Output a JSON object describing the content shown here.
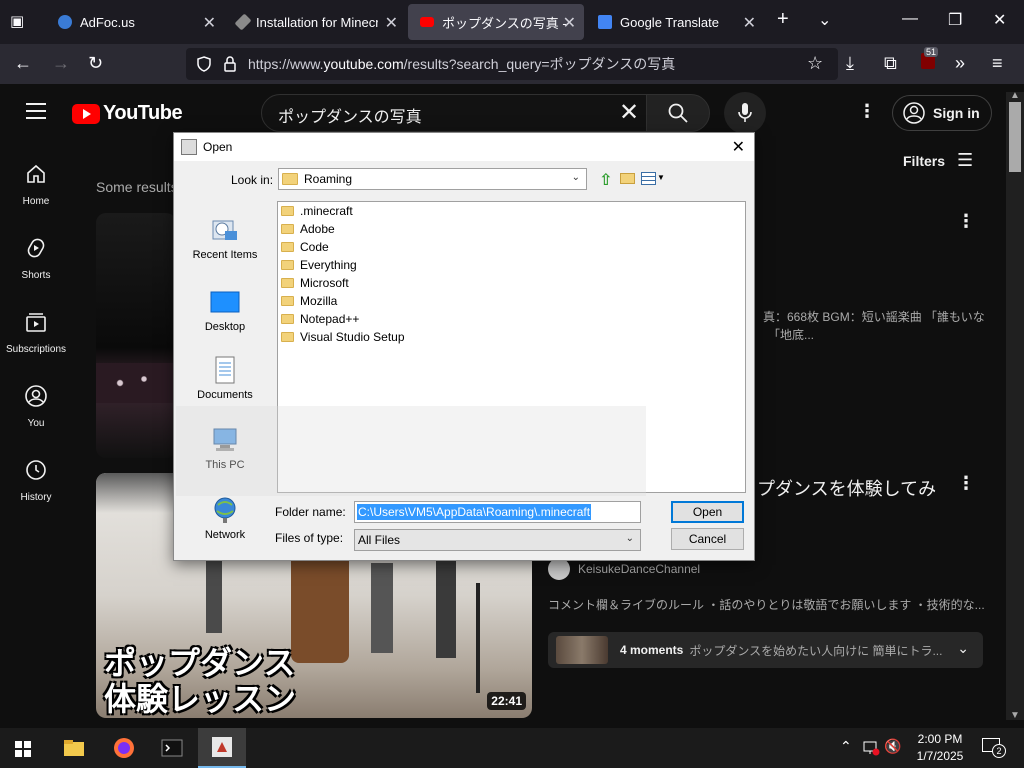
{
  "browser": {
    "tabs": [
      {
        "label": "AdFoc.us",
        "icon": "adfocus-icon"
      },
      {
        "label": "Installation for Minecraft",
        "icon": "pencil-icon"
      },
      {
        "label": "ポップダンスの写真 -",
        "icon": "youtube-icon",
        "active": true
      },
      {
        "label": "Google Translate",
        "icon": "translate-icon"
      }
    ],
    "url_prefix": "https://www.",
    "url_domain": "youtube.com",
    "url_rest": "/results?search_query=ポップダンスの写真",
    "badge_count": "51"
  },
  "youtube": {
    "logo_text": "YouTube",
    "search_value": "ポップダンスの写真",
    "signin_label": "Sign in",
    "filters_label": "Filters",
    "results_note": "Some results",
    "sidebar": [
      {
        "label": "Home",
        "icon": "home-icon"
      },
      {
        "label": "Shorts",
        "icon": "shorts-icon"
      },
      {
        "label": "Subscriptions",
        "icon": "subscriptions-icon"
      },
      {
        "label": "You",
        "icon": "you-icon"
      },
      {
        "label": "History",
        "icon": "history-icon"
      }
    ],
    "result1_desc_line1": "真：668枚 BGM：短い謡楽曲 「誰もいな",
    "result1_desc_line2": "「地底...",
    "result2_title": "プダンスを体験してみ",
    "result2_channel": "KeisukeDanceChannel",
    "result2_desc": "コメント欄＆ライブのルール ・話のやりとりは敬語でお願いします ・技術的な...",
    "moments_count": "4 moments",
    "moments_text": "ポップダンスを始めたい人向けに 簡単にトラ...",
    "thumb_text_line1": "ポップダンス",
    "thumb_text_line2": "体験レッスン",
    "duration": "22:41"
  },
  "dialog": {
    "title": "Open",
    "look_in_label": "Look in:",
    "look_in_value": "Roaming",
    "places": [
      {
        "label": "Recent Items"
      },
      {
        "label": "Desktop"
      },
      {
        "label": "Documents"
      },
      {
        "label": "This PC"
      },
      {
        "label": "Network"
      }
    ],
    "folders": [
      ".minecraft",
      "Adobe",
      "Code",
      "Everything",
      "Microsoft",
      "Mozilla",
      "Notepad++",
      "Visual Studio Setup"
    ],
    "folder_name_label": "Folder name:",
    "folder_name_value": "C:\\Users\\VM5\\AppData\\Roaming\\.minecraft",
    "files_of_type_label": "Files of type:",
    "files_of_type_value": "All Files",
    "open_label": "Open",
    "cancel_label": "Cancel"
  },
  "taskbar": {
    "time": "2:00 PM",
    "date": "1/7/2025",
    "notification_count": "2"
  }
}
